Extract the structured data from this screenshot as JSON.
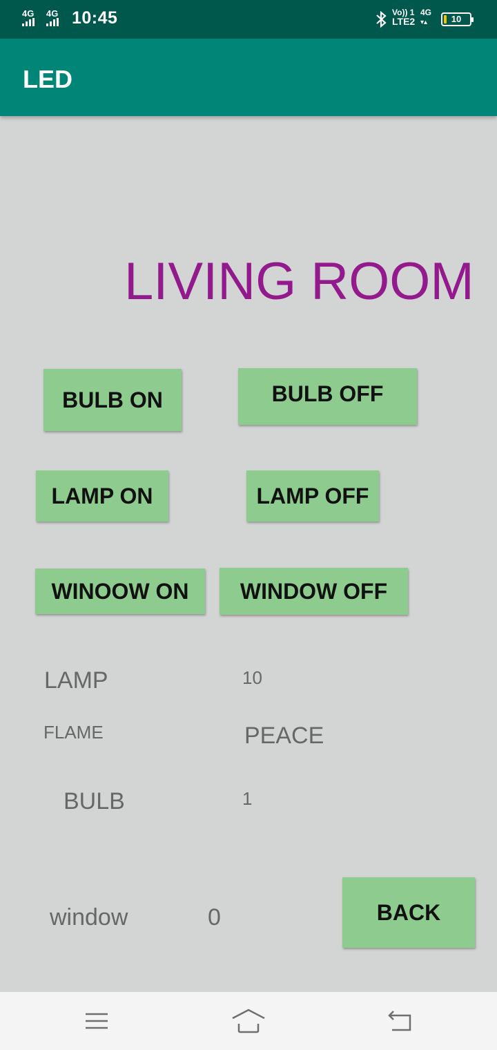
{
  "status_bar": {
    "network_left_1": "4G",
    "network_left_2": "4G",
    "time": "10:45",
    "volte": "Vo))",
    "lte_sim": "1",
    "lte_label": "LTE2",
    "network_right": "4G",
    "battery_level": "10",
    "battery_fraction": 0.1,
    "battery_fill_color": "#f2c500"
  },
  "app_bar": {
    "title": "LED",
    "background": "#008577"
  },
  "screen": {
    "title": "LIVING ROOM",
    "title_color": "#921a8c",
    "buttons": {
      "bulb_on": "BULB ON",
      "bulb_off": "BULB OFF",
      "lamp_on": "LAMP ON",
      "lamp_off": "LAMP OFF",
      "window_on": "WINOOW ON",
      "window_off": "WINDOW OFF",
      "back": "BACK"
    },
    "button_color": "#8ecb8e",
    "readings": {
      "lamp_label": "LAMP",
      "lamp_value": "10",
      "flame_label": "FLAME",
      "flame_value": "PEACE",
      "bulb_label": "BULB",
      "bulb_value": "1",
      "window_label": "window",
      "window_value": "0"
    }
  },
  "nav_bar": {
    "icons": [
      "menu-icon",
      "home-icon",
      "back-icon"
    ]
  }
}
